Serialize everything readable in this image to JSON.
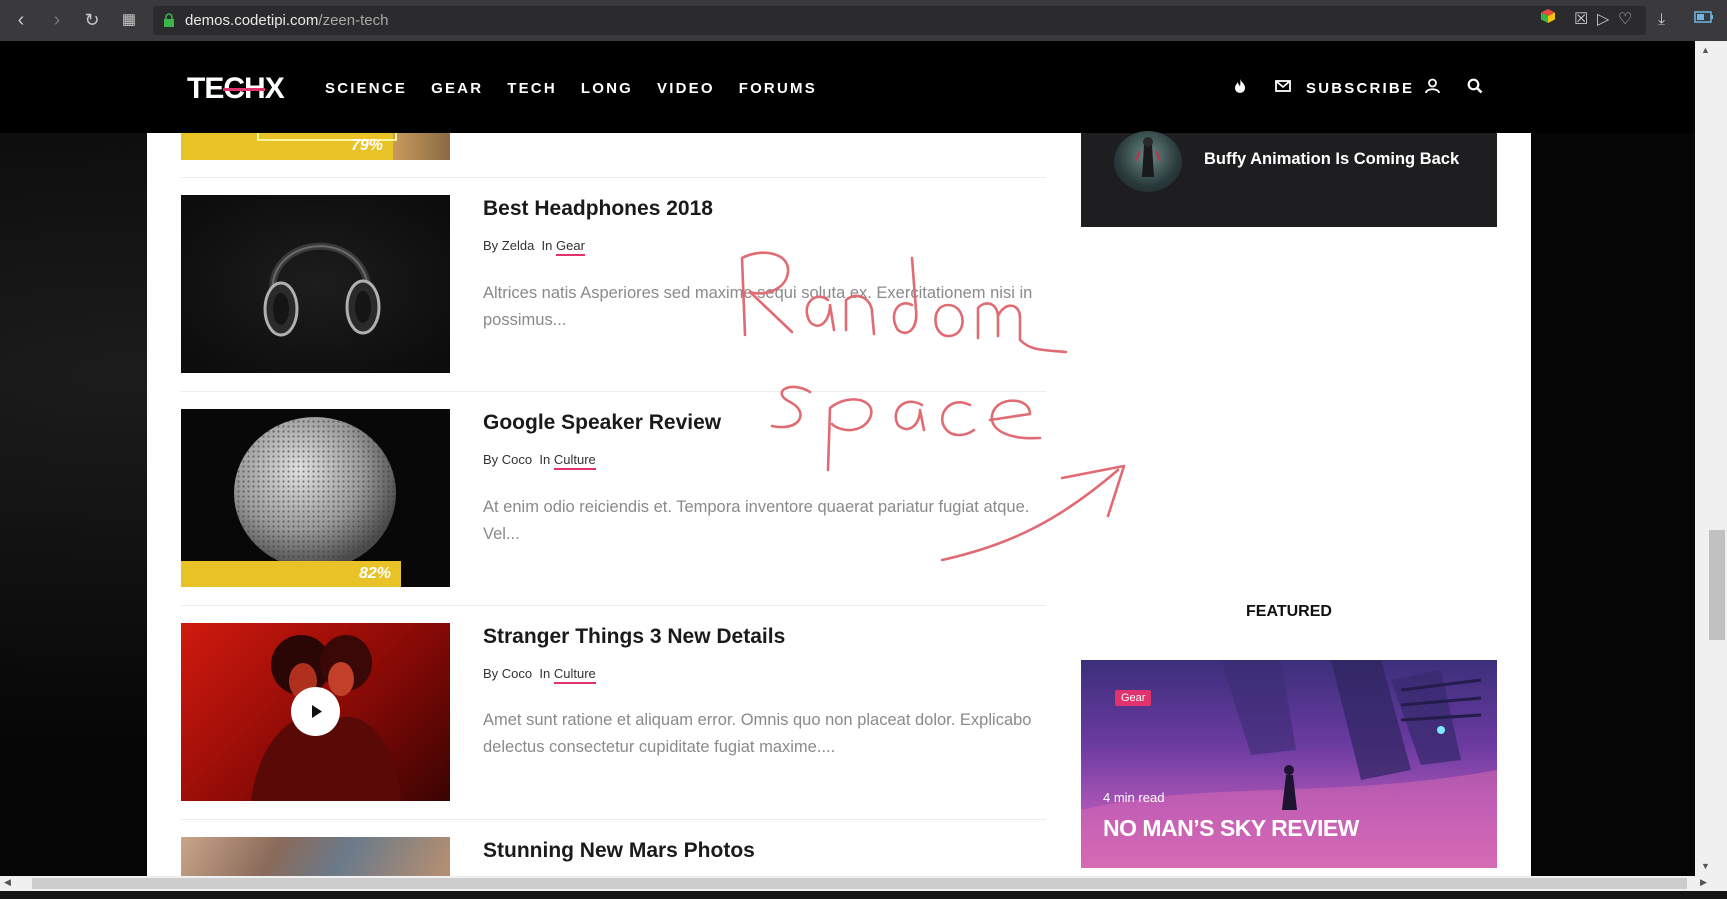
{
  "browser": {
    "url_host": "demos.codetipi.com",
    "url_path": "/zeen-tech"
  },
  "site": {
    "logo": "TECHX",
    "nav": [
      "SCIENCE",
      "GEAR",
      "TECH",
      "LONG",
      "VIDEO",
      "FORUMS"
    ],
    "subscribe_label": "SUBSCRIBE"
  },
  "top_partial": {
    "score": "79%"
  },
  "articles": [
    {
      "title": "Best Headphones 2018",
      "by": "By Zelda",
      "in": "In",
      "category": "Gear",
      "excerpt": "Altrices natis Asperiores sed maxime sequi soluta ex. Exercitationem nisi in possimus..."
    },
    {
      "title": "Google Speaker Review",
      "by": "By Coco",
      "in": "In",
      "category": "Culture",
      "excerpt": "At enim odio reiciendis et. Tempora inventore quaerat pariatur fugiat atque. Vel...",
      "score": "82%"
    },
    {
      "title": "Stranger Things 3 New Details",
      "by": "By Coco",
      "in": "In",
      "category": "Culture",
      "excerpt": "Amet sunt ratione et aliquam error. Omnis quo non placeat dolor. Explicabo delectus consectetur cupiditate fugiat maxime...."
    },
    {
      "title": "Stunning New Mars Photos"
    }
  ],
  "sidebar": {
    "trending_title": "Buffy Animation Is Coming Back",
    "featured_heading": "FEATURED",
    "featured": {
      "badge": "Gear",
      "read_time": "4 min read",
      "title": "NO MAN’S SKY REVIEW"
    }
  },
  "annotation": {
    "line1": "Random",
    "line2": "space",
    "color": "#e06b72"
  }
}
